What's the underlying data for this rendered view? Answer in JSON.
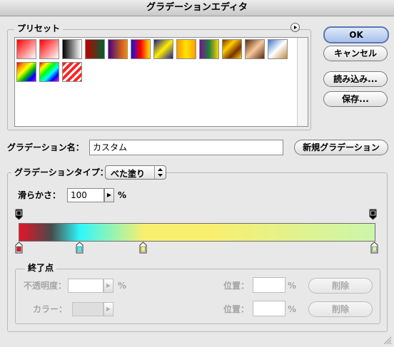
{
  "window": {
    "title": "グラデーションエディタ"
  },
  "presets": {
    "legend": "プリセット",
    "menu_icon": "circle-arrow-icon",
    "swatches": [
      "linear-gradient(135deg,#ff0000,#ffffff)",
      "linear-gradient(135deg,#ff0000,rgba(255,255,255,0.2))",
      "linear-gradient(90deg,#000000,#ffffff)",
      "linear-gradient(90deg,#c00000,#006030)",
      "linear-gradient(90deg,#4a0080,#ff8a00)",
      "linear-gradient(90deg,#1010e0,#ff0000,#ffe000)",
      "linear-gradient(135deg,#1a1a90,#ffee00 50%,#1a1a90)",
      "linear-gradient(90deg,#ff9a00,#ffe400,#ff9a00)",
      "linear-gradient(90deg,#7a1090,#208040,#ffd000)",
      "linear-gradient(135deg,#7a3000,#ffcc00,#7a3000,#ffcc00)",
      "linear-gradient(135deg,#5a2a10,#f6c89a,#5a2a10)",
      "linear-gradient(135deg,#3a78c8,#ffffff 50%,#c08a3a)",
      "linear-gradient(135deg,#ff0000,#ff9900,#ffff00,#00c000,#0000ff,#9900ff)",
      "linear-gradient(135deg,#ff0000,#ffff00,#00ff00,#00ffff,#0000ff,#ff00ff)",
      "repeating-linear-gradient(135deg,#ff2020 0 4px,#ffffff 4px 7px)"
    ]
  },
  "buttons": {
    "ok": "OK",
    "cancel": "キャンセル",
    "load": "読み込み...",
    "save": "保存...",
    "new_gradient": "新規グラデーション"
  },
  "name": {
    "label": "グラデーション名：",
    "value": "カスタム"
  },
  "type": {
    "label": "グラデーションタイプ：",
    "selected": "べた塗り",
    "smoothness_label": "滑らかさ：",
    "smoothness_value": "100",
    "unit": "%"
  },
  "gradient": {
    "colors": [
      "#e5142a",
      "#4a4a4a",
      "#2ef7fb",
      "#f8ef70",
      "#ccf6ac"
    ],
    "color_stops": [
      {
        "color": "#e5142a",
        "location": 0
      },
      {
        "color": "#2ef7fb",
        "location": 17
      },
      {
        "color": "#f8ef70",
        "location": 35
      },
      {
        "color": "#ccf6ac",
        "location": 100
      }
    ],
    "opacity_stops": [
      0,
      100
    ]
  },
  "stops_panel": {
    "legend": "終了点",
    "opacity_label": "不透明度：",
    "opacity_unit": "%",
    "location_label": "位置：",
    "location_unit": "%",
    "delete_label": "削除",
    "color_label": "カラー："
  }
}
